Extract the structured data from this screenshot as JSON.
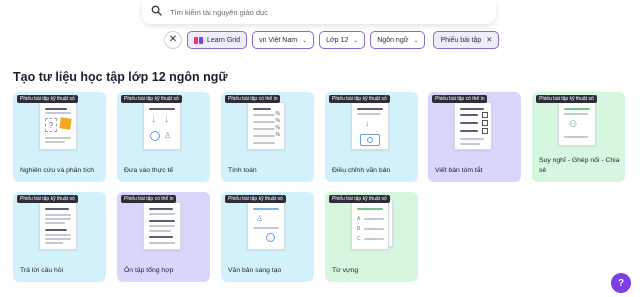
{
  "search": {
    "placeholder": "Tìm kiếm tài nguyên giáo dục"
  },
  "filters": {
    "brand": "Learn Grid",
    "region": "vn Việt Nam",
    "grade": "Lớp 12",
    "subject": "Ngôn ngữ",
    "type": "Phiếu bài tập"
  },
  "heading": "Tạo tư liệu học tập lớp 12 ngôn ngữ",
  "cards": [
    {
      "badge": "Phiếu bài tập kỹ thuật số",
      "title": "Nghiên cứu và phân tích",
      "color": "#d3f1fb"
    },
    {
      "badge": "Phiếu bài tập kỹ thuật số",
      "title": "Đưa vào thực tế",
      "color": "#d3f1fb"
    },
    {
      "badge": "Phiếu bài tập có thể in",
      "title": "Tính toán",
      "color": "#d3f1fb"
    },
    {
      "badge": "Phiếu bài tập kỹ thuật số",
      "title": "Điều chỉnh văn bản",
      "color": "#d3f1fb"
    },
    {
      "badge": "Phiếu bài tập có thể in",
      "title": "Viết bản tóm tắt",
      "color": "#d8d6fb"
    },
    {
      "badge": "Phiếu bài tập kỹ thuật số",
      "title": "Suy nghĩ - Ghép nối - Chia sẻ",
      "color": "#d7f6e0"
    },
    {
      "badge": "Phiếu bài tập kỹ thuật số",
      "title": "Trả lời câu hỏi",
      "color": "#d3f1fb"
    },
    {
      "badge": "Phiếu bài tập có thể in",
      "title": "Ôn tập tổng hợp",
      "color": "#d8d6fb"
    },
    {
      "badge": "Phiếu bài tập kỹ thuật số",
      "title": "Văn bản sáng tạo",
      "color": "#d3f1fb"
    },
    {
      "badge": "Phiếu bài tập kỹ thuật số",
      "title": "Từ vựng",
      "color": "#d7f6e0"
    }
  ],
  "help": {
    "label": "?"
  },
  "colors": {
    "accent": "#7b3fe4",
    "chip_border": "#7d6fd0"
  }
}
